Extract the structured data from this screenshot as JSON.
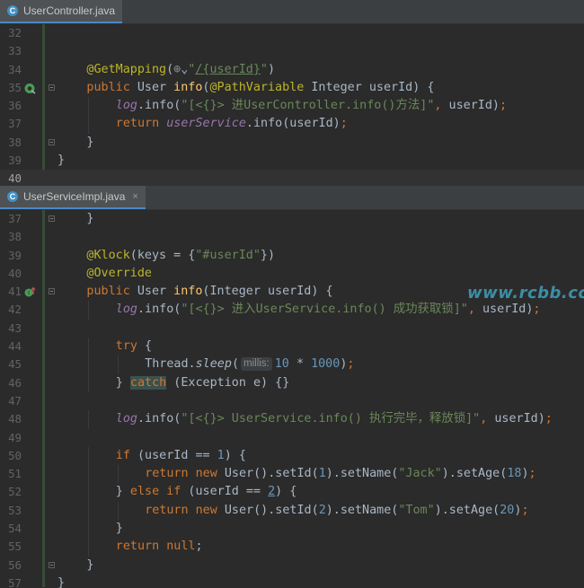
{
  "editor1": {
    "tab_label": "UserController.java",
    "tab_icon": "C",
    "lines": [
      {
        "num": "32",
        "segments": []
      },
      {
        "num": "33",
        "segments": []
      },
      {
        "num": "34",
        "segments": [
          {
            "c": "a",
            "t": "@GetMapping"
          },
          {
            "c": "",
            "t": "("
          },
          {
            "c": "globe",
            "t": "⊕"
          },
          {
            "c": "",
            "t": "⌄"
          },
          {
            "c": "s",
            "t": "\""
          },
          {
            "c": "s u",
            "t": "/{userId}"
          },
          {
            "c": "s",
            "t": "\""
          },
          {
            "c": "",
            "t": ")"
          }
        ]
      },
      {
        "num": "35",
        "segments": [
          {
            "c": "k",
            "t": "public "
          },
          {
            "c": "",
            "t": "User "
          },
          {
            "c": "m",
            "t": "info"
          },
          {
            "c": "",
            "t": "("
          },
          {
            "c": "a",
            "t": "@PathVariable "
          },
          {
            "c": "",
            "t": "Integer userId) {"
          }
        ]
      },
      {
        "num": "36",
        "segments": [
          {
            "c": "f",
            "t": "log"
          },
          {
            "c": "",
            "t": ".info("
          },
          {
            "c": "s",
            "t": "\"[<{}> 进UserController.info()方法]\""
          },
          {
            "c": "k",
            "t": ", "
          },
          {
            "c": "",
            "t": "userId)"
          },
          {
            "c": "k",
            "t": ";"
          }
        ]
      },
      {
        "num": "37",
        "segments": [
          {
            "c": "k",
            "t": "return "
          },
          {
            "c": "f",
            "t": "userService"
          },
          {
            "c": "",
            "t": ".info(userId)"
          },
          {
            "c": "k",
            "t": ";"
          }
        ]
      },
      {
        "num": "38",
        "segments": [
          {
            "c": "",
            "t": "}"
          }
        ]
      },
      {
        "num": "39",
        "segments": [
          {
            "c": "",
            "t": "}"
          }
        ]
      },
      {
        "num": "40",
        "segments": []
      }
    ]
  },
  "editor2": {
    "tab_label": "UserServiceImpl.java",
    "tab_icon": "C",
    "tab_close": "×",
    "lines": [
      {
        "num": "37",
        "segments": [
          {
            "c": "",
            "t": "}"
          }
        ]
      },
      {
        "num": "38",
        "segments": []
      },
      {
        "num": "39",
        "segments": [
          {
            "c": "a",
            "t": "@Klock"
          },
          {
            "c": "",
            "t": "(keys = {"
          },
          {
            "c": "s",
            "t": "\"#userId\""
          },
          {
            "c": "",
            "t": "})"
          }
        ]
      },
      {
        "num": "40",
        "segments": [
          {
            "c": "a",
            "t": "@Override"
          }
        ]
      },
      {
        "num": "41",
        "segments": [
          {
            "c": "k",
            "t": "public "
          },
          {
            "c": "",
            "t": "User "
          },
          {
            "c": "m",
            "t": "info"
          },
          {
            "c": "",
            "t": "(Integer userId) {"
          }
        ]
      },
      {
        "num": "42",
        "segments": [
          {
            "c": "f",
            "t": "log"
          },
          {
            "c": "",
            "t": ".info("
          },
          {
            "c": "s",
            "t": "\"[<{}> 进入UserService.info() 成功获取锁]\""
          },
          {
            "c": "k",
            "t": ", "
          },
          {
            "c": "",
            "t": "userId)"
          },
          {
            "c": "k",
            "t": ";"
          }
        ]
      },
      {
        "num": "43",
        "segments": []
      },
      {
        "num": "44",
        "segments": [
          {
            "c": "k",
            "t": "try "
          },
          {
            "c": "",
            "t": "{"
          }
        ]
      },
      {
        "num": "45",
        "segments": [
          {
            "c": "",
            "t": "Thread."
          },
          {
            "c": "i",
            "t": "sleep"
          },
          {
            "c": "",
            "t": "("
          },
          {
            "c": "hint",
            "t": "millis:"
          },
          {
            "c": "n",
            "t": "10 "
          },
          {
            "c": "",
            "t": "* "
          },
          {
            "c": "n",
            "t": "1000"
          },
          {
            "c": "",
            "t": ")"
          },
          {
            "c": "k",
            "t": ";"
          }
        ]
      },
      {
        "num": "46",
        "segments": [
          {
            "c": "",
            "t": "} "
          },
          {
            "c": "k catch",
            "t": "catch"
          },
          {
            "c": "",
            "t": " (Exception e) {}"
          }
        ]
      },
      {
        "num": "47",
        "segments": []
      },
      {
        "num": "48",
        "segments": [
          {
            "c": "f",
            "t": "log"
          },
          {
            "c": "",
            "t": ".info("
          },
          {
            "c": "s",
            "t": "\"[<{}> UserService.info() 执行完毕，释放锁]\""
          },
          {
            "c": "k",
            "t": ", "
          },
          {
            "c": "",
            "t": "userId)"
          },
          {
            "c": "k",
            "t": ";"
          }
        ]
      },
      {
        "num": "49",
        "segments": []
      },
      {
        "num": "50",
        "segments": [
          {
            "c": "k",
            "t": "if "
          },
          {
            "c": "",
            "t": "(userId == "
          },
          {
            "c": "n",
            "t": "1"
          },
          {
            "c": "",
            "t": ") {"
          }
        ]
      },
      {
        "num": "51",
        "segments": [
          {
            "c": "k",
            "t": "return new "
          },
          {
            "c": "",
            "t": "User().setId("
          },
          {
            "c": "n",
            "t": "1"
          },
          {
            "c": "",
            "t": ").setName("
          },
          {
            "c": "s",
            "t": "\"Jack\""
          },
          {
            "c": "",
            "t": ").setAge("
          },
          {
            "c": "n",
            "t": "18"
          },
          {
            "c": "",
            "t": ")"
          },
          {
            "c": "k",
            "t": ";"
          }
        ]
      },
      {
        "num": "52",
        "segments": [
          {
            "c": "",
            "t": "} "
          },
          {
            "c": "k",
            "t": "else if "
          },
          {
            "c": "",
            "t": "(userId == "
          },
          {
            "c": "n u",
            "t": "2"
          },
          {
            "c": "",
            "t": ") {"
          }
        ]
      },
      {
        "num": "53",
        "segments": [
          {
            "c": "k",
            "t": "return new "
          },
          {
            "c": "",
            "t": "User().setId("
          },
          {
            "c": "n",
            "t": "2"
          },
          {
            "c": "",
            "t": ").setName("
          },
          {
            "c": "s",
            "t": "\"Tom\""
          },
          {
            "c": "",
            "t": ").setAge("
          },
          {
            "c": "n",
            "t": "20"
          },
          {
            "c": "",
            "t": ")"
          },
          {
            "c": "k",
            "t": ";"
          }
        ]
      },
      {
        "num": "54",
        "segments": [
          {
            "c": "",
            "t": "}"
          }
        ]
      },
      {
        "num": "55",
        "segments": [
          {
            "c": "k",
            "t": "return null"
          },
          {
            "c": "",
            "t": ";"
          }
        ]
      },
      {
        "num": "56",
        "segments": [
          {
            "c": "",
            "t": "}"
          }
        ]
      },
      {
        "num": "57",
        "segments": [
          {
            "c": "",
            "t": "}"
          }
        ]
      }
    ]
  },
  "watermark": "www.rcbb.cc",
  "colors": {
    "background": "#2b2b2b",
    "keyword": "#cc7832",
    "annotation": "#bbb529",
    "string": "#6a8759",
    "number": "#6897bb",
    "field": "#9876aa",
    "method": "#ffc66d",
    "watermark": "#3b8ea5"
  }
}
